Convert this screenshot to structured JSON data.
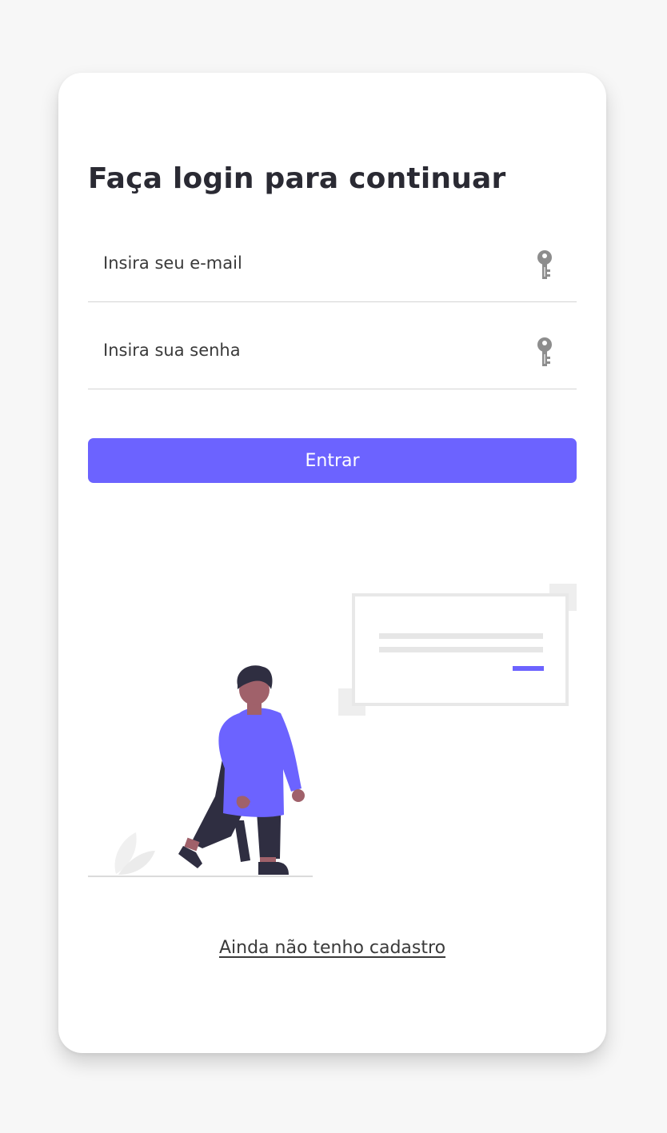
{
  "login": {
    "title": "Faça login para continuar",
    "email_placeholder": "Insira seu e-mail",
    "email_value": "",
    "password_placeholder": "Insira sua senha",
    "password_value": "",
    "submit_label": "Entrar",
    "signup_link": "Ainda não tenho cadastro"
  },
  "icons": {
    "email_field_icon": "key-icon",
    "password_field_icon": "key-icon"
  },
  "colors": {
    "accent": "#6c63ff",
    "page_background": "#f7f7f7",
    "card_background": "#ffffff",
    "text": "#2a2a33",
    "person_skin": "#a0616a",
    "person_hair": "#2f2e41",
    "person_pants": "#2f2e41"
  }
}
